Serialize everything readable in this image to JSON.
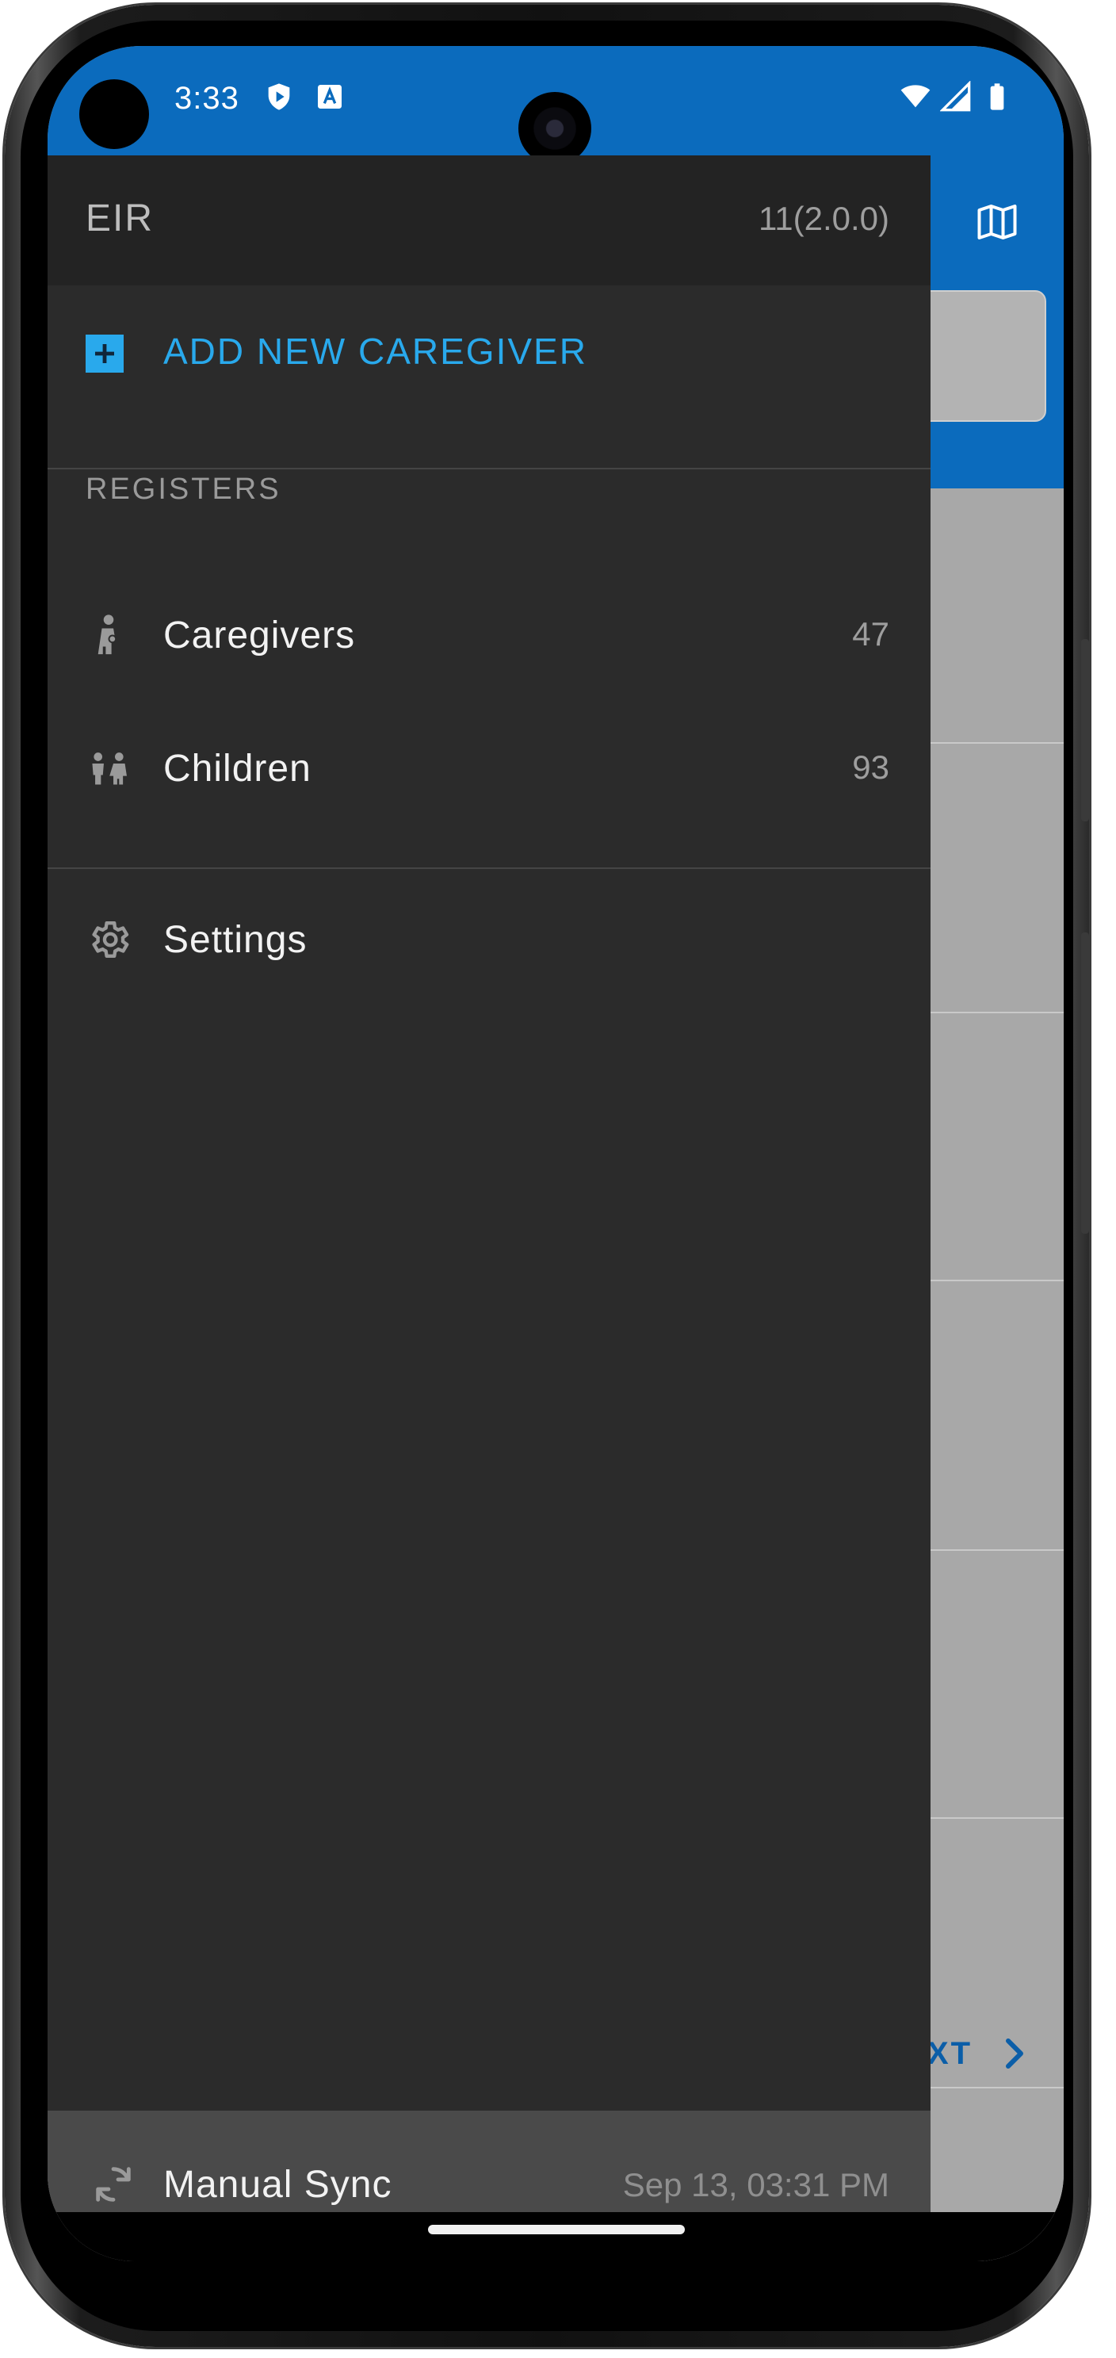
{
  "status_bar": {
    "time": "3:33",
    "icons": [
      "play-protect-icon",
      "keyboard-a-icon",
      "wifi-icon",
      "signal-icon",
      "battery-icon"
    ]
  },
  "drawer": {
    "title": "EIR",
    "version": "11(2.0.0)",
    "add_new_label": "ADD NEW CAREGIVER",
    "section_registers": "REGISTERS",
    "items": [
      {
        "label": "Caregivers",
        "count": "47",
        "icon": "caregiver-icon"
      },
      {
        "label": "Children",
        "count": "93",
        "icon": "children-icon"
      }
    ],
    "settings_label": "Settings",
    "sync": {
      "label": "Manual Sync",
      "last_sync": "Sep 13, 03:31 PM"
    }
  },
  "background_app": {
    "next_label": "XT"
  },
  "colors": {
    "accent": "#29a9ec",
    "toolbar_blue": "#0b6bbd",
    "drawer_bg": "#2b2b2b",
    "drawer_header_bg": "#232323",
    "sync_bar_bg": "#4a4a4a"
  }
}
